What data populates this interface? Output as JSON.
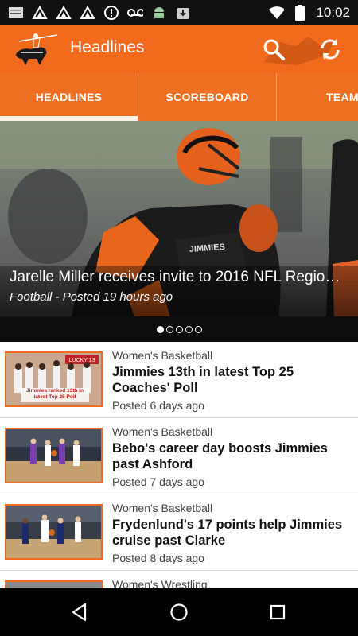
{
  "status_bar": {
    "time": "10:02",
    "left_icons": [
      "notes-icon",
      "drive-icon",
      "drive-icon",
      "drive-icon",
      "alert-icon",
      "voicemail-icon",
      "android-icon",
      "download-icon"
    ],
    "right_icons": [
      "wifi-icon",
      "battery-icon"
    ]
  },
  "app_bar": {
    "title": "Headlines",
    "actions": [
      "search-icon",
      "refresh-icon"
    ]
  },
  "tabs": [
    {
      "label": "HEADLINES",
      "active": true
    },
    {
      "label": "SCOREBOARD",
      "active": false
    },
    {
      "label": "TEAM",
      "active": false
    }
  ],
  "hero": {
    "title": "Jarelle Miller receives invite to 2016 NFL Regio…",
    "sport": "Football",
    "posted": "- Posted 19 hours ago",
    "jersey_text": "JIMMIES",
    "slide_count": 5,
    "active_slide": 1
  },
  "articles": [
    {
      "category": "Women's Basketball",
      "title": "Jimmies 13th in latest Top 25 Coaches' Poll",
      "posted": "Posted 6 days ago",
      "thumb_text": "Jimmies ranked 13th in latest Top 25 Poll",
      "banner_text": "LUCKY 13"
    },
    {
      "category": "Women's Basketball",
      "title": "Bebo's career day boosts Jimmies past Ashford",
      "posted": "Posted 7 days ago"
    },
    {
      "category": "Women's Basketball",
      "title": "Frydenlund's 17 points help Jimmies cruise past Clarke",
      "posted": "Posted 8 days ago"
    },
    {
      "category": "Women's Wrestling",
      "title": "",
      "posted": ""
    }
  ],
  "colors": {
    "accent": "#f26b1d",
    "status_bar": "#111111",
    "nav_bar": "#000000"
  }
}
